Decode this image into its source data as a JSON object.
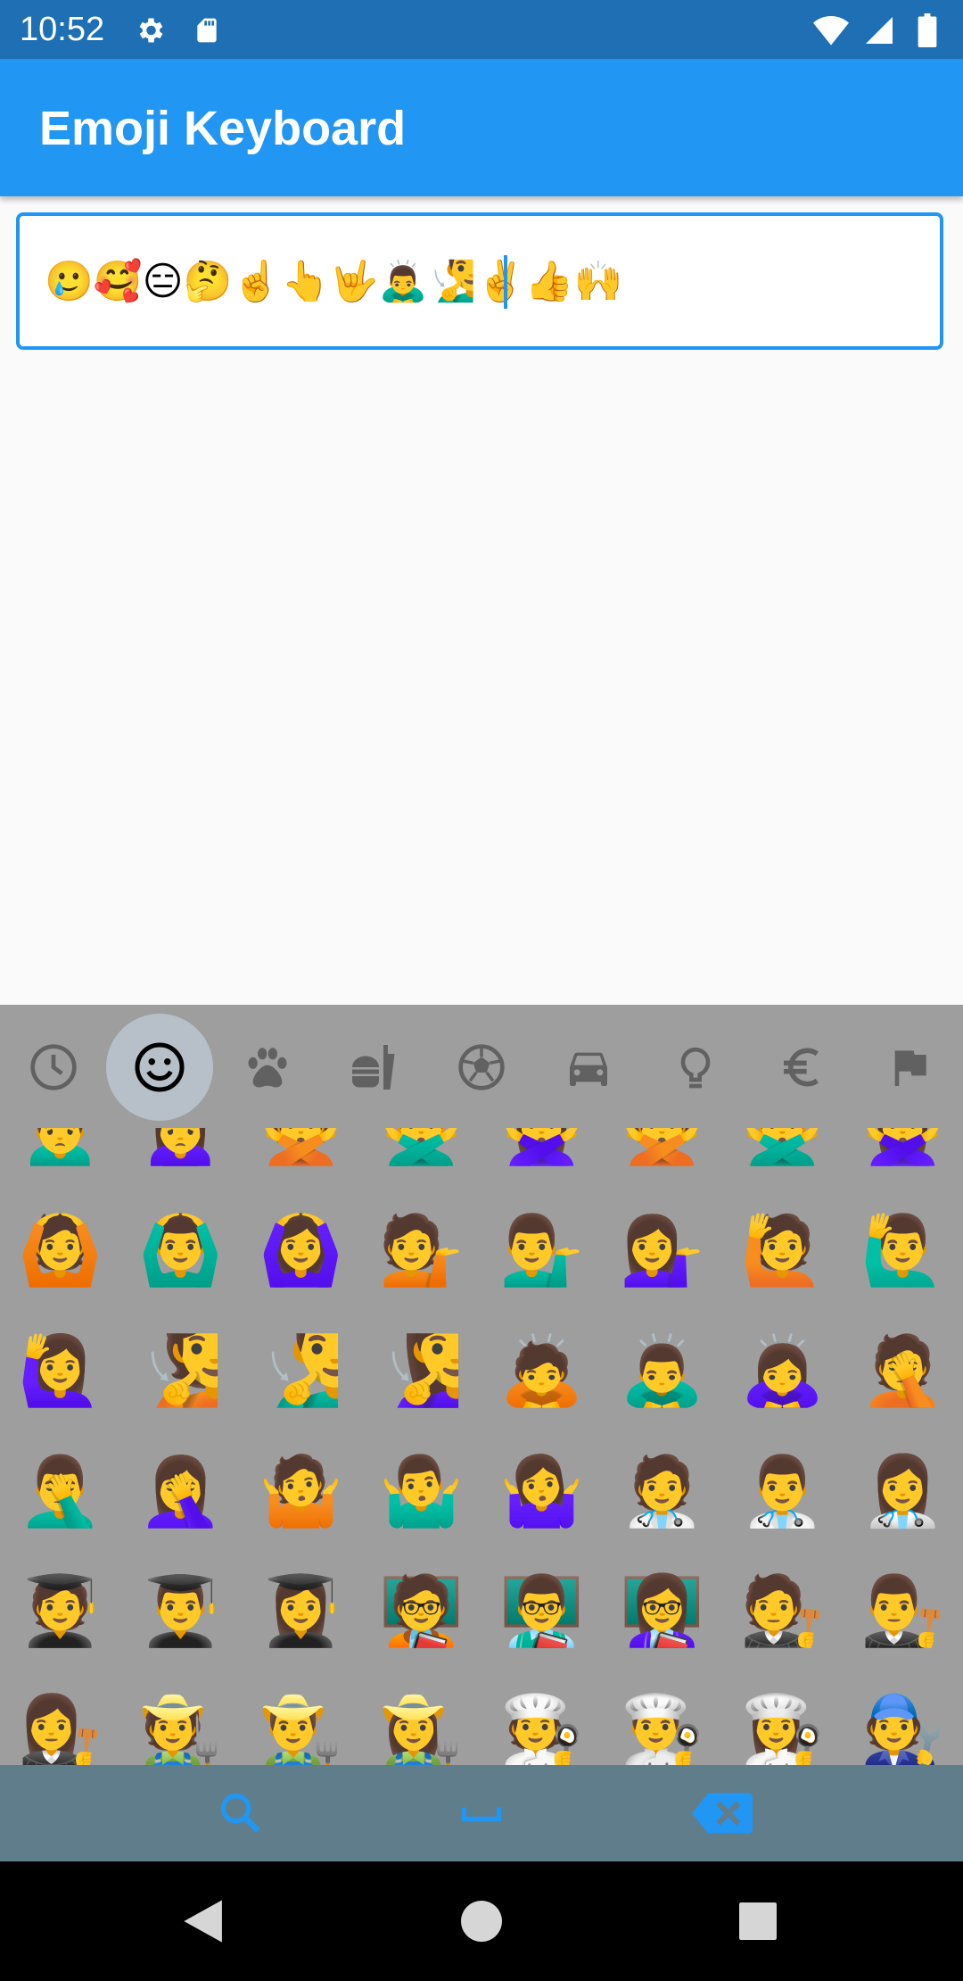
{
  "status_bar": {
    "time": "10:52",
    "icons": [
      "settings-icon",
      "sd-card-icon",
      "wifi-icon",
      "signal-icon",
      "battery-icon"
    ]
  },
  "app_bar": {
    "title": "Emoji Keyboard"
  },
  "text_field": {
    "value": "🥲🥰😑🤔☝️👆🤟🙇‍♂️🧏‍♂️✌️👍🙌"
  },
  "emoji_panel": {
    "categories": [
      {
        "icon": "recent-clock-icon",
        "active": false
      },
      {
        "icon": "smiley-face-icon",
        "active": true
      },
      {
        "icon": "paw-icon",
        "active": false
      },
      {
        "icon": "food-drink-icon",
        "active": false
      },
      {
        "icon": "soccer-ball-icon",
        "active": false
      },
      {
        "icon": "car-icon",
        "active": false
      },
      {
        "icon": "lightbulb-icon",
        "active": false
      },
      {
        "icon": "euro-symbol-icon",
        "active": false
      },
      {
        "icon": "flag-icon",
        "active": false
      }
    ],
    "colors": {
      "panel_bg": "#9e9e9e",
      "category_icon": "#616161",
      "active_bubble": "#b7c0c8",
      "action_bar": "#607d8b",
      "accent": "#2196f3"
    },
    "rows": [
      [
        "🙍‍♂️",
        "🙍‍♀️",
        "🙅",
        "🙅‍♂️",
        "🙅‍♀️",
        "🙅",
        "🙅‍♂️",
        "🙅‍♀️"
      ],
      [
        "🙆",
        "🙆‍♂️",
        "🙆‍♀️",
        "💁",
        "💁‍♂️",
        "💁‍♀️",
        "🙋",
        "🙋‍♂️"
      ],
      [
        "🙋‍♀️",
        "🧏",
        "🧏‍♂️",
        "🧏‍♀️",
        "🙇",
        "🙇‍♂️",
        "🙇‍♀️",
        "🤦"
      ],
      [
        "🤦‍♂️",
        "🤦‍♀️",
        "🤷",
        "🤷‍♂️",
        "🤷‍♀️",
        "🧑‍⚕️",
        "👨‍⚕️",
        "👩‍⚕️"
      ],
      [
        "🧑‍🎓",
        "👨‍🎓",
        "👩‍🎓",
        "🧑‍🏫",
        "👨‍🏫",
        "👩‍🏫",
        "🧑‍⚖️",
        "👨‍⚖️"
      ],
      [
        "👩‍⚖️",
        "🧑‍🌾",
        "👨‍🌾",
        "👩‍🌾",
        "🧑‍🍳",
        "👨‍🍳",
        "👩‍🍳",
        "🧑‍🔧"
      ]
    ]
  },
  "action_bar": {
    "buttons": [
      "search-icon",
      "space-bar-icon",
      "backspace-icon"
    ]
  },
  "nav_bar": {
    "buttons": [
      "back-triangle-icon",
      "home-circle-icon",
      "recents-square-icon"
    ]
  }
}
